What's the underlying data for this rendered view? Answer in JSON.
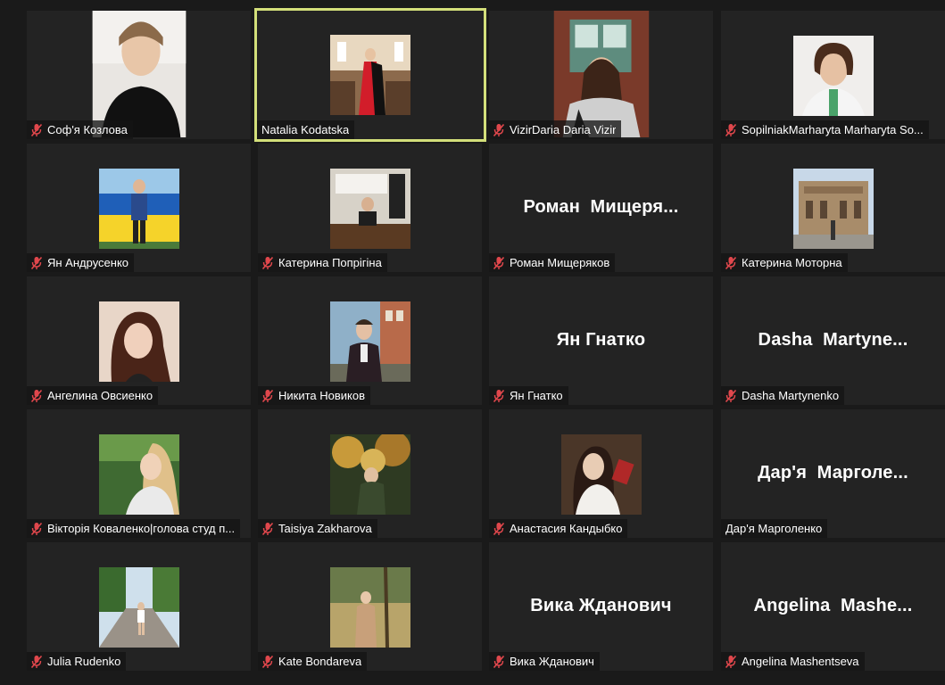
{
  "participants": [
    {
      "name": "Соф'я Козлова",
      "muted": true,
      "video": true,
      "photo": "portrait-woman-black-top",
      "active": false
    },
    {
      "name": "Natalia Kodatska",
      "muted": false,
      "video": true,
      "photo": "woman-red-dress-hall",
      "active": true
    },
    {
      "name": "VizirDaria Daria Vizir",
      "muted": true,
      "video": true,
      "photo": "woman-brick-window",
      "active": false
    },
    {
      "name": "SopilniakMarharyta Marharyta So...",
      "muted": true,
      "video": true,
      "photo": "woman-white-coat",
      "active": false
    },
    {
      "name": "Ян Андрусенко",
      "muted": true,
      "video": true,
      "photo": "man-ukrainian-flag",
      "active": false
    },
    {
      "name": "Катерина Попрігіна",
      "muted": true,
      "video": true,
      "photo": "person-office-desk",
      "active": false
    },
    {
      "name": "Роман Мищеряков",
      "muted": true,
      "video": false,
      "display_name": "Роман  Мищеря...",
      "active": false
    },
    {
      "name": "Катерина Моторна",
      "muted": true,
      "video": true,
      "photo": "opera-house-square",
      "active": false
    },
    {
      "name": "Ангелина Овсиенко",
      "muted": true,
      "video": true,
      "photo": "young-woman-selfie",
      "active": false
    },
    {
      "name": "Никита Новиков",
      "muted": true,
      "video": true,
      "photo": "man-dark-jacket-street",
      "active": false
    },
    {
      "name": "Ян Гнатко",
      "muted": true,
      "video": false,
      "display_name": "Ян Гнатко",
      "active": false
    },
    {
      "name": "Dasha Martynenko",
      "muted": true,
      "video": false,
      "display_name": "Dasha  Martyne...",
      "active": false
    },
    {
      "name": "Вікторія Коваленко|голова студ п...",
      "muted": true,
      "video": true,
      "photo": "woman-trees-smile",
      "active": false
    },
    {
      "name": "Taisiya Zakharova",
      "muted": true,
      "video": true,
      "photo": "person-autumn-trees",
      "active": false
    },
    {
      "name": "Анастасия Кандыбко",
      "muted": true,
      "video": true,
      "photo": "painting-woman-reading",
      "active": false
    },
    {
      "name": "Дар'я Марголенко",
      "muted": false,
      "video": false,
      "display_name": "Дар'я  Марголе...",
      "active": false
    },
    {
      "name": "Julia Rudenko",
      "muted": true,
      "video": true,
      "photo": "woman-cobblestone-street",
      "active": false
    },
    {
      "name": "Kate Bondareva",
      "muted": true,
      "video": true,
      "photo": "woman-autumn-field",
      "active": false
    },
    {
      "name": "Вика Жданович",
      "muted": true,
      "video": false,
      "display_name": "Вика Жданович",
      "active": false
    },
    {
      "name": "Angelina Mashentseva",
      "muted": true,
      "video": false,
      "display_name": "Angelina  Mashe...",
      "active": false
    }
  ],
  "icons": {
    "muted_mic": "mic-muted-icon"
  },
  "colors": {
    "active_border": "#d3df7a",
    "muted_icon": "#e0474c",
    "tile_bg": "#232323"
  }
}
